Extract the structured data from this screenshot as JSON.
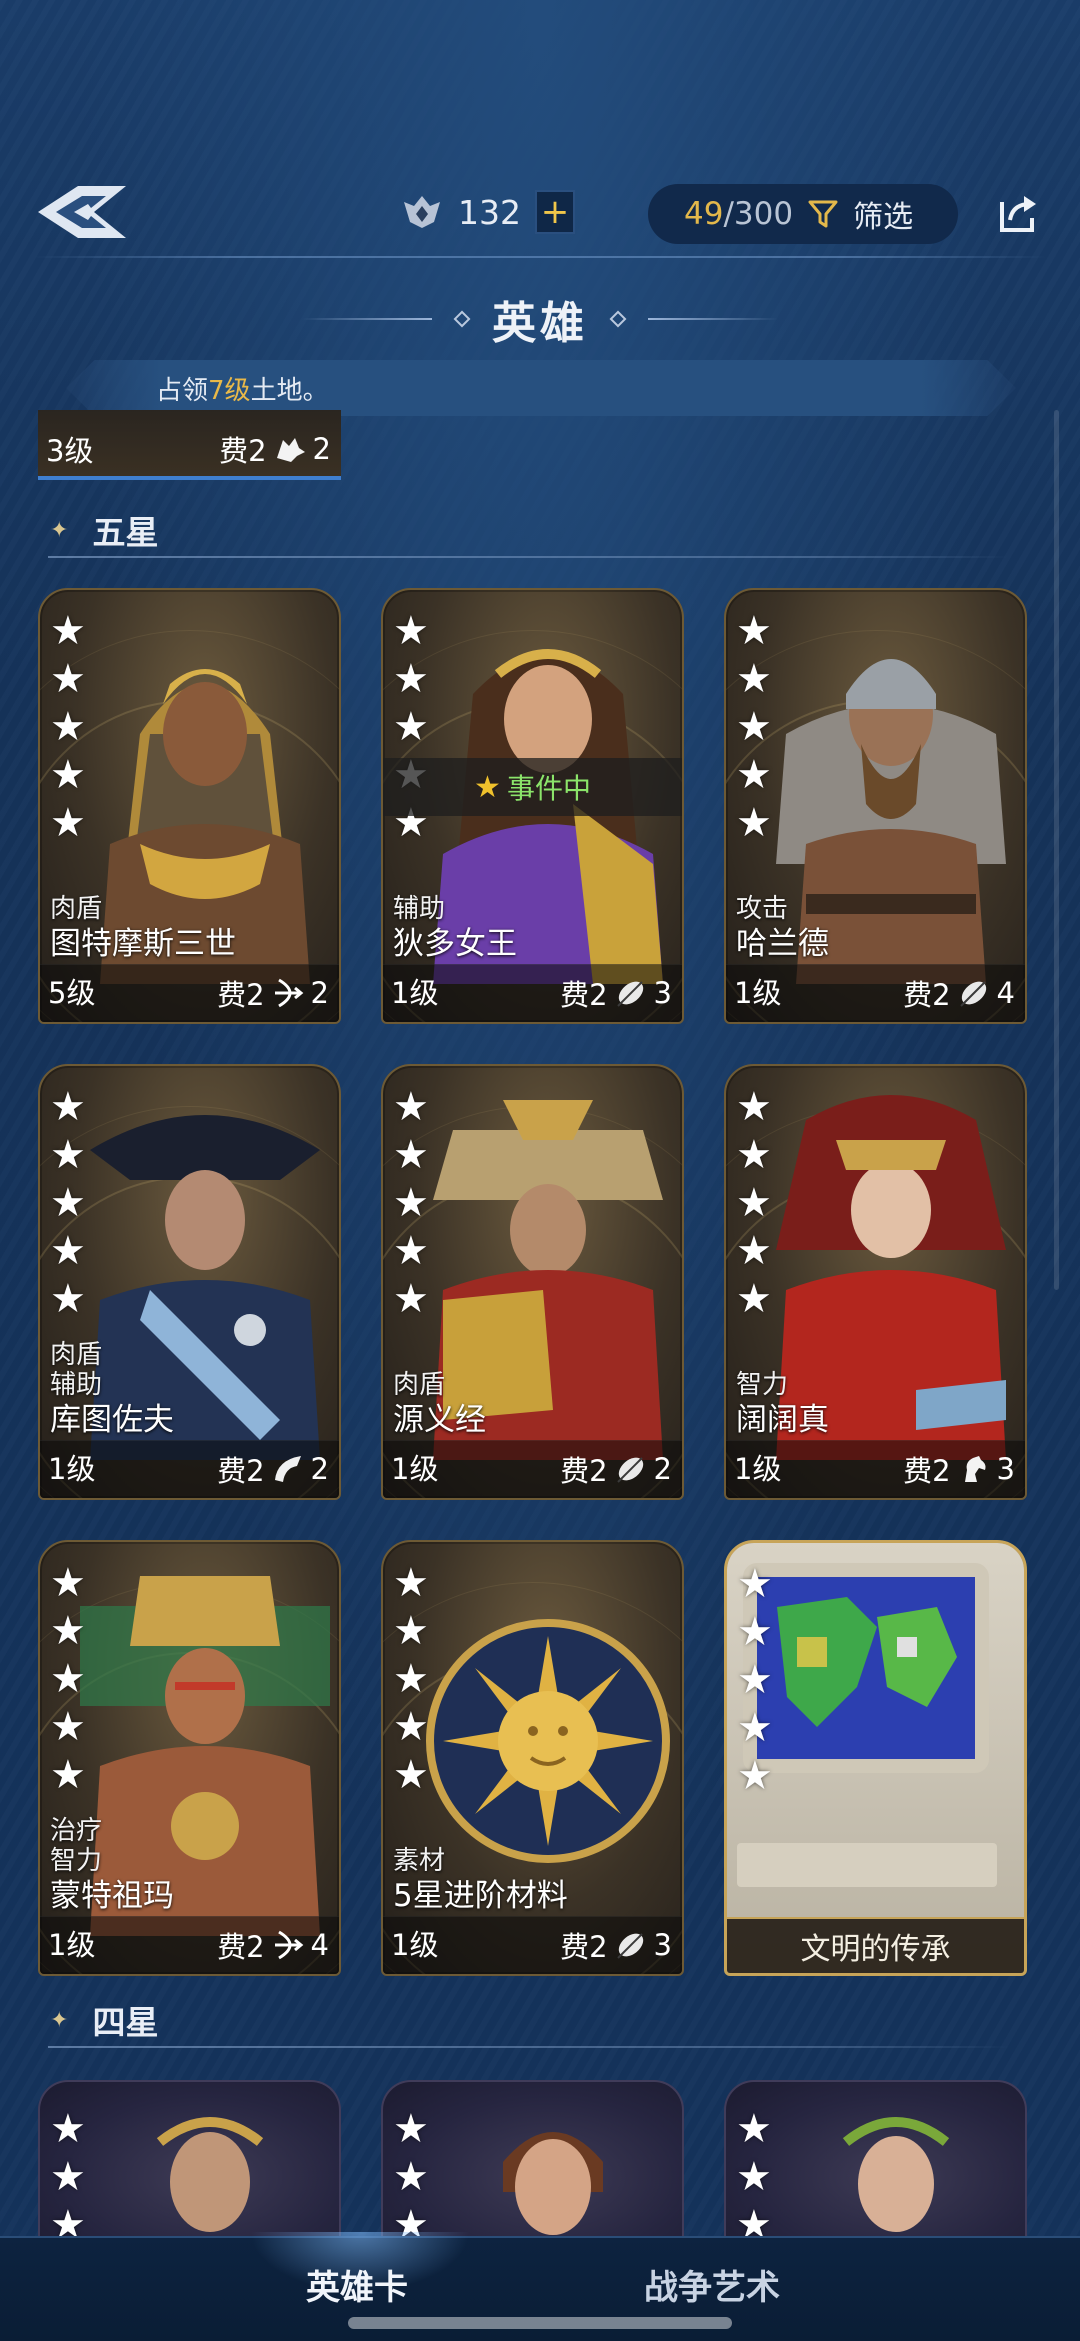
{
  "header": {
    "currency_value": "132",
    "plus_label": "+",
    "capacity_current": "49",
    "capacity_total": "/300",
    "filter_label": "筛选"
  },
  "page_title": "英雄",
  "notice": {
    "prefix": "占领",
    "highlight": "7级",
    "suffix": "土地。"
  },
  "partial_card": {
    "level": "3级",
    "cost": "费2",
    "value": "2"
  },
  "sections": [
    {
      "label": "五星"
    },
    {
      "label": "四星"
    }
  ],
  "five_star_cards": [
    {
      "roles": [
        "肉盾"
      ],
      "name": "图特摩斯三世",
      "level": "5级",
      "cost": "费2",
      "trait_icon": "bow-icon",
      "trait_value": "2",
      "stars": 5
    },
    {
      "roles": [
        "辅助"
      ],
      "name": "狄多女王",
      "level": "1级",
      "cost": "费2",
      "trait_icon": "feather-icon",
      "trait_value": "3",
      "stars": 5,
      "event_label": "事件中"
    },
    {
      "roles": [
        "攻击"
      ],
      "name": "哈兰德",
      "level": "1级",
      "cost": "费2",
      "trait_icon": "feather-icon",
      "trait_value": "4",
      "stars": 5
    },
    {
      "roles": [
        "肉盾",
        "辅助"
      ],
      "name": "库图佐夫",
      "level": "1级",
      "cost": "费2",
      "trait_icon": "horn-icon",
      "trait_value": "2",
      "stars": 5
    },
    {
      "roles": [
        "肉盾"
      ],
      "name": "源义经",
      "level": "1级",
      "cost": "费2",
      "trait_icon": "feather-icon",
      "trait_value": "2",
      "stars": 5
    },
    {
      "roles": [
        "智力"
      ],
      "name": "阔阔真",
      "level": "1级",
      "cost": "费2",
      "trait_icon": "horse-icon",
      "trait_value": "3",
      "stars": 5
    },
    {
      "roles": [
        "治疗",
        "智力"
      ],
      "name": "蒙特祖玛",
      "level": "1级",
      "cost": "费2",
      "trait_icon": "bow-icon",
      "trait_value": "4",
      "stars": 5
    },
    {
      "roles": [
        "素材"
      ],
      "name": "5星进阶材料",
      "level": "1级",
      "cost": "费2",
      "trait_icon": "feather-icon",
      "trait_value": "3",
      "stars": 5
    }
  ],
  "special_card": {
    "label": "文明的传承",
    "stars": 5
  },
  "bottom_nav": {
    "tab_hero_cards": "英雄卡",
    "tab_art_of_war": "战争艺术"
  },
  "colors": {
    "background": "#14335c",
    "accent_gold": "#e3b84b",
    "event_green": "#8be46a"
  }
}
